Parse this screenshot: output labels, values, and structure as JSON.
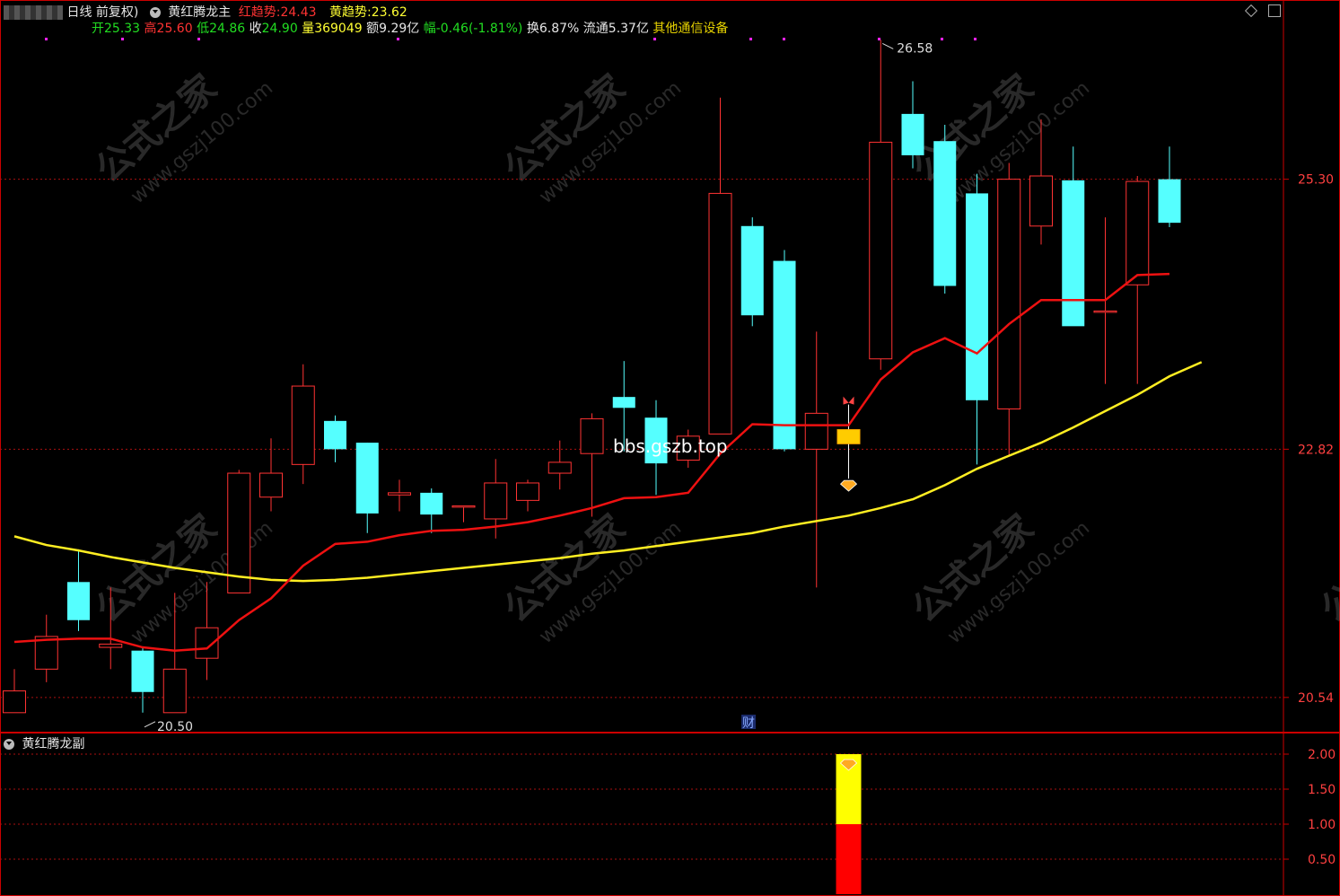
{
  "header": {
    "period": "日线 前复权)",
    "indicator_name": "黄红腾龙主",
    "red_trend_label": "红趋势:",
    "red_trend_value": "24.43",
    "yellow_trend_label": "黄趋势:",
    "yellow_trend_value": "23.62",
    "open_label": "开",
    "open_value": "25.33",
    "high_label": "高",
    "high_value": "25.60",
    "low_label": "低",
    "low_value": "24.86",
    "close_label": "收",
    "close_value": "24.90",
    "volume_label": "量",
    "volume_value": "369049",
    "amount_label": "额",
    "amount_value": "9.29亿",
    "change_label": "幅",
    "change_value": "-0.46(-1.81%)",
    "turnover_label": "换",
    "turnover_value": "6.87%",
    "float_label": "流通",
    "float_value": "5.37亿",
    "sector": "其他通信设备"
  },
  "sub_header": {
    "indicator_name": "黄红腾龙副"
  },
  "watermark": {
    "cn": "公式之家",
    "url": "www.gszj100.com",
    "site": "bbs.gszb.top"
  },
  "markers": {
    "cai": "财",
    "high_label": "26.58",
    "low_label": "20.50"
  },
  "colors": {
    "up": "#ff3333",
    "down": "#55ffff",
    "red_line": "#ee1111",
    "yellow_line": "#ffee22",
    "grid": "#aa1111",
    "axis": "#cc0000",
    "signal": "#ffcc00"
  },
  "chart_data": [
    {
      "type": "candlestick",
      "title": "黄红腾龙主",
      "y_ticks": [
        20.54,
        22.82,
        25.3
      ],
      "y_tick_labels": [
        "20.54",
        "22.82",
        "25.30"
      ],
      "ylim": [
        20.25,
        26.6
      ],
      "grid": true,
      "candles": [
        {
          "o": 20.4,
          "h": 20.8,
          "l": 20.4,
          "c": 20.6
        },
        {
          "o": 20.8,
          "h": 21.3,
          "l": 20.68,
          "c": 21.1
        },
        {
          "o": 21.6,
          "h": 21.9,
          "l": 21.15,
          "c": 21.25
        },
        {
          "o": 21.0,
          "h": 21.55,
          "l": 20.8,
          "c": 21.03
        },
        {
          "o": 20.97,
          "h": 21.0,
          "l": 20.4,
          "c": 20.59
        },
        {
          "o": 20.4,
          "h": 21.5,
          "l": 20.4,
          "c": 20.8
        },
        {
          "o": 20.9,
          "h": 21.6,
          "l": 20.7,
          "c": 21.18
        },
        {
          "o": 21.5,
          "h": 22.63,
          "l": 21.5,
          "c": 22.6
        },
        {
          "o": 22.38,
          "h": 22.92,
          "l": 22.25,
          "c": 22.6
        },
        {
          "o": 22.68,
          "h": 23.6,
          "l": 22.5,
          "c": 23.4
        },
        {
          "o": 23.08,
          "h": 23.13,
          "l": 22.7,
          "c": 22.82
        },
        {
          "o": 22.88,
          "h": 22.88,
          "l": 22.05,
          "c": 22.23
        },
        {
          "o": 22.4,
          "h": 22.54,
          "l": 22.25,
          "c": 22.42
        },
        {
          "o": 22.42,
          "h": 22.46,
          "l": 22.05,
          "c": 22.22
        },
        {
          "o": 22.3,
          "h": 22.3,
          "l": 22.15,
          "c": 22.3
        },
        {
          "o": 22.18,
          "h": 22.73,
          "l": 22.0,
          "c": 22.51
        },
        {
          "o": 22.35,
          "h": 22.54,
          "l": 22.25,
          "c": 22.51
        },
        {
          "o": 22.6,
          "h": 22.9,
          "l": 22.45,
          "c": 22.7
        },
        {
          "o": 22.78,
          "h": 23.15,
          "l": 22.2,
          "c": 23.1
        },
        {
          "o": 23.3,
          "h": 23.63,
          "l": 22.8,
          "c": 23.2
        },
        {
          "o": 23.11,
          "h": 23.27,
          "l": 22.4,
          "c": 22.69
        },
        {
          "o": 22.72,
          "h": 23.0,
          "l": 22.65,
          "c": 22.94
        },
        {
          "o": 22.96,
          "h": 26.05,
          "l": 22.96,
          "c": 25.17
        },
        {
          "o": 24.87,
          "h": 24.95,
          "l": 23.95,
          "c": 24.05
        },
        {
          "o": 24.55,
          "h": 24.65,
          "l": 22.8,
          "c": 22.82
        },
        {
          "o": 22.82,
          "h": 23.9,
          "l": 21.55,
          "c": 23.15
        },
        {
          "o": 22.87,
          "h": 23.23,
          "l": 22.55,
          "c": 23.0
        },
        {
          "o": 23.65,
          "h": 26.58,
          "l": 23.55,
          "c": 25.64
        },
        {
          "o": 25.9,
          "h": 26.2,
          "l": 25.4,
          "c": 25.52
        },
        {
          "o": 25.65,
          "h": 25.8,
          "l": 24.25,
          "c": 24.32
        },
        {
          "o": 25.17,
          "h": 25.35,
          "l": 22.68,
          "c": 23.27
        },
        {
          "o": 23.19,
          "h": 25.45,
          "l": 22.76,
          "c": 25.3
        },
        {
          "o": 24.87,
          "h": 25.85,
          "l": 24.7,
          "c": 25.33
        },
        {
          "o": 25.29,
          "h": 25.6,
          "l": 24.09,
          "c": 23.95
        },
        {
          "o": 24.09,
          "h": 24.95,
          "l": 23.42,
          "c": 24.09
        },
        {
          "o": 24.33,
          "h": 25.33,
          "l": 23.42,
          "c": 25.28
        },
        {
          "o": 25.3,
          "h": 25.6,
          "l": 24.86,
          "c": 24.9
        }
      ],
      "red_trend": [
        21.05,
        21.07,
        21.08,
        21.08,
        21.0,
        20.97,
        20.99,
        21.25,
        21.45,
        21.75,
        21.95,
        21.97,
        22.03,
        22.07,
        22.08,
        22.11,
        22.15,
        22.21,
        22.28,
        22.37,
        22.38,
        22.42,
        22.78,
        23.05,
        23.04,
        23.04,
        23.04,
        23.46,
        23.71,
        23.84,
        23.7,
        23.97,
        24.19,
        24.19,
        24.19,
        24.42,
        24.43
      ],
      "yellow_trend": [
        22.02,
        21.94,
        21.89,
        21.83,
        21.78,
        21.73,
        21.69,
        21.65,
        21.62,
        21.61,
        21.62,
        21.64,
        21.67,
        21.7,
        21.73,
        21.76,
        21.79,
        21.82,
        21.86,
        21.89,
        21.93,
        21.97,
        22.01,
        22.05,
        22.11,
        22.16,
        22.21,
        22.28,
        22.36,
        22.49,
        22.64,
        22.76,
        22.88,
        23.02,
        23.17,
        23.32,
        23.49,
        23.62
      ],
      "signal_candle_index": 26
    },
    {
      "type": "bar",
      "title": "黄红腾龙副",
      "y_ticks": [
        0.5,
        1.0,
        1.5,
        2.0
      ],
      "y_tick_labels": [
        "0.50",
        "1.00",
        "1.50",
        "2.00"
      ],
      "ylim": [
        0,
        2.0
      ],
      "bar_index": 26,
      "segments": [
        {
          "value": 1.0,
          "color": "#ff0000"
        },
        {
          "value": 1.0,
          "color": "#ffff00"
        }
      ]
    }
  ]
}
